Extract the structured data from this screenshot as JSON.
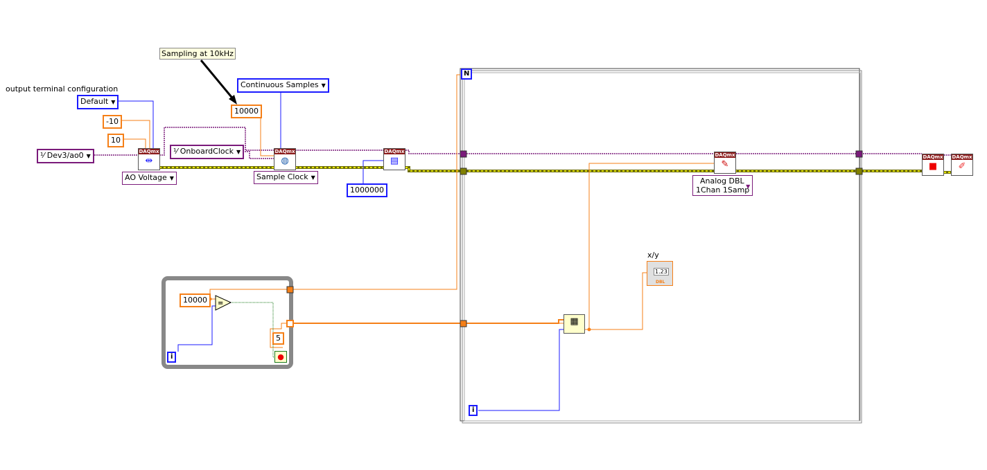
{
  "labels": {
    "terminal_config": "output terminal configuration",
    "comment": "Sampling at 10kHz",
    "indicator": "x/y"
  },
  "constants": {
    "terminal_config": "Default",
    "min": "-10",
    "max": "10",
    "channel": "Dev3/ao0",
    "clock_source": "OnboardClock",
    "rate": "10000",
    "sample_mode": "Continuous Samples",
    "buffer_size": "1000000",
    "while_limit": "10000",
    "five": "5"
  },
  "selectors": {
    "create_channel": "AO Voltage",
    "timing": "Sample Clock",
    "write_line1": "Analog DBL",
    "write_line2": "1Chan 1Samp"
  },
  "nodes": {
    "header": "DAQmx",
    "indicator_value": "1.23",
    "indicator_type": "DBL"
  },
  "loops": {
    "for_count": "N",
    "for_index": "i",
    "while_index": "i"
  },
  "colors": {
    "task_wire": "#7a1a7a",
    "error_wire": "#c8c800",
    "numeric": "#f57f17",
    "enum": "#1a1aff",
    "node_header": "#8b1a1a"
  }
}
